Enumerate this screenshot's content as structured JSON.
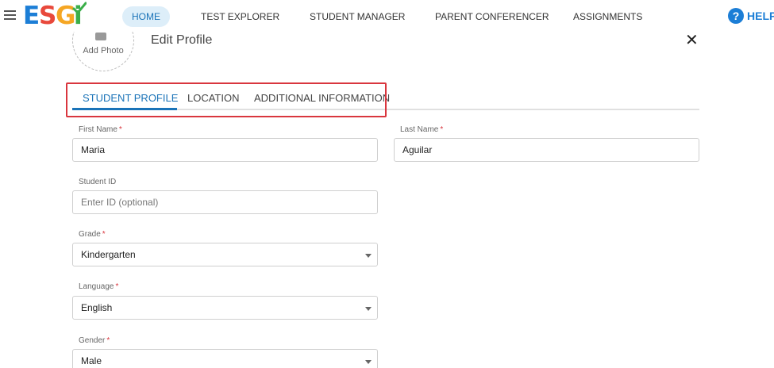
{
  "nav": {
    "logo_letters": [
      "E",
      "S",
      "G",
      "i"
    ],
    "items": [
      {
        "label": "HOME",
        "active": true
      },
      {
        "label": "TEST EXPLORER",
        "active": false
      },
      {
        "label": "STUDENT MANAGER",
        "active": false
      },
      {
        "label": "PARENT CONFERENCER",
        "active": false
      },
      {
        "label": "ASSIGNMENTS",
        "active": false
      }
    ],
    "help_label": "HELP",
    "help_icon": "?"
  },
  "profile": {
    "add_photo": "Add Photo",
    "title": "Edit Profile",
    "close_icon": "✕"
  },
  "tabs": [
    {
      "label": "STUDENT PROFILE",
      "active": true
    },
    {
      "label": "LOCATION",
      "active": false
    },
    {
      "label": "ADDITIONAL INFORMATION",
      "active": false
    }
  ],
  "form": {
    "first_name": {
      "label": "First Name",
      "required": "*",
      "value": "Maria"
    },
    "last_name": {
      "label": "Last Name",
      "required": "*",
      "value": "Aguilar"
    },
    "student_id": {
      "label": "Student ID",
      "placeholder": "Enter ID (optional)"
    },
    "grade": {
      "label": "Grade",
      "required": "*",
      "value": "Kindergarten"
    },
    "language": {
      "label": "Language",
      "required": "*",
      "value": "English"
    },
    "gender": {
      "label": "Gender",
      "required": "*",
      "value": "Male"
    }
  },
  "colors": {
    "accent": "#1a73b8",
    "highlight_box": "#d9363e",
    "logo_e": "#1c7ed6",
    "logo_s": "#e8483b",
    "logo_g": "#f5a623",
    "logo_i": "#3aae49"
  }
}
